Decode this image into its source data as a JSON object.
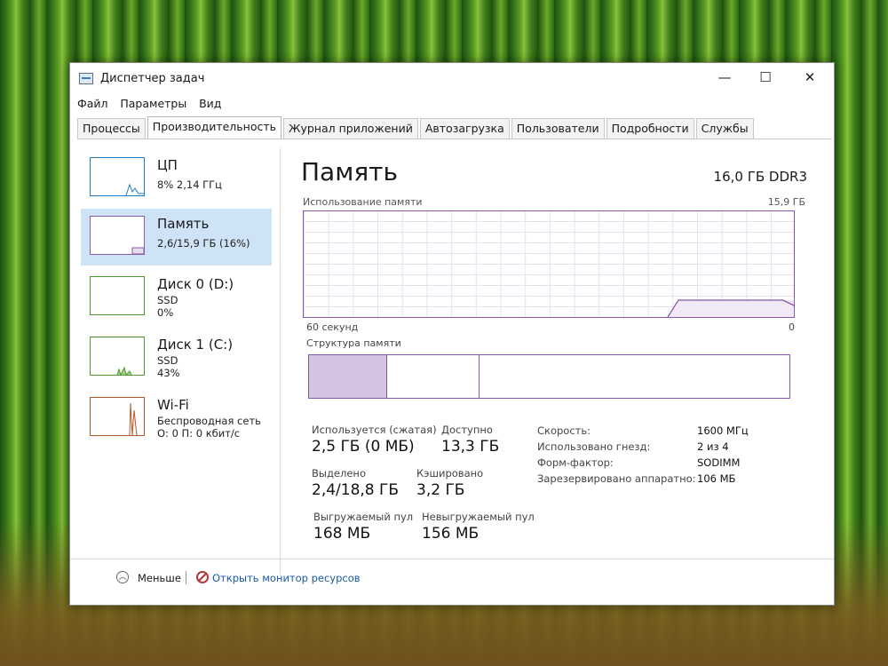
{
  "window": {
    "title": "Диспетчер задач",
    "controls": {
      "minimize": "—",
      "maximize": "☐",
      "close": "✕"
    }
  },
  "menu": [
    "Файл",
    "Параметры",
    "Вид"
  ],
  "tabs": [
    "Процессы",
    "Производительность",
    "Журнал приложений",
    "Автозагрузка",
    "Пользователи",
    "Подробности",
    "Службы"
  ],
  "active_tab": "Производительность",
  "sidebar": {
    "items": [
      {
        "name": "ЦП",
        "line1": "8% 2,14 ГГц",
        "line2": ""
      },
      {
        "name": "Память",
        "line1": "2,6/15,9 ГБ (16%)",
        "line2": ""
      },
      {
        "name": "Диск 0 (D:)",
        "line1": "SSD",
        "line2": "0%"
      },
      {
        "name": "Диск 1 (C:)",
        "line1": "SSD",
        "line2": "43%"
      },
      {
        "name": "Wi-Fi",
        "line1": "Беспроводная сеть",
        "line2": "О: 0 П: 0 кбит/с"
      }
    ]
  },
  "main": {
    "title": "Память",
    "spec": "16,0 ГБ DDR3",
    "graph": {
      "label": "Использование памяти",
      "max": "15,9 ГБ",
      "left_axis": "60 секунд",
      "right_axis": "0"
    },
    "structure_label": "Структура памяти",
    "stats": {
      "in_use": {
        "label": "Используется (сжатая)",
        "value": "2,5 ГБ (0 МБ)"
      },
      "available": {
        "label": "Доступно",
        "value": "13,3 ГБ"
      },
      "committed": {
        "label": "Выделено",
        "value": "2,4/18,8 ГБ"
      },
      "cached": {
        "label": "Кэшировано",
        "value": "3,2 ГБ"
      },
      "paged_pool": {
        "label": "Выгружаемый пул",
        "value": "168 МБ"
      },
      "nonpaged_pool": {
        "label": "Невыгружаемый пул",
        "value": "156 МБ"
      }
    },
    "details": [
      {
        "label": "Скорость:",
        "value": "1600 МГц"
      },
      {
        "label": "Использовано гнезд:",
        "value": "2 из 4"
      },
      {
        "label": "Форм-фактор:",
        "value": "SODIMM"
      },
      {
        "label": "Зарезервировано аппаратно:",
        "value": "106 МБ"
      }
    ]
  },
  "footer": {
    "less": "Меньше",
    "resource_monitor": "Открыть монитор ресурсов"
  },
  "colors": {
    "memory_accent": "#8a58a8",
    "cpu_accent": "#1f7ac2",
    "disk_accent": "#4f9a2c",
    "wifi_accent": "#b05a2a",
    "selected_bg": "#cfe3f6"
  },
  "icons": [
    "task-manager-icon",
    "chevron-up-icon",
    "resource-monitor-icon"
  ]
}
